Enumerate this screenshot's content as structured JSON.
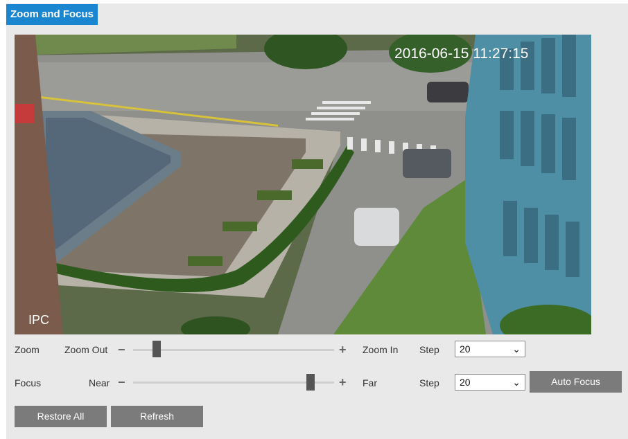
{
  "header": {
    "title": "Zoom and Focus"
  },
  "video": {
    "timestamp": "2016-06-15 11:27:15",
    "watermark": "IPC"
  },
  "zoom": {
    "label": "Zoom",
    "minus_label": "Zoom Out",
    "plus_label": "Zoom In",
    "position_fraction": 0.1,
    "step_label": "Step",
    "step_value": "20"
  },
  "focus": {
    "label": "Focus",
    "minus_label": "Near",
    "plus_label": "Far",
    "position_fraction": 0.9,
    "step_label": "Step",
    "step_value": "20",
    "auto_focus_label": "Auto Focus"
  },
  "actions": {
    "restore_all_label": "Restore All",
    "refresh_label": "Refresh"
  },
  "colors": {
    "accent": "#1a86cf",
    "button": "#7b7b7b",
    "panel": "#e9e9e9"
  },
  "icons": {
    "minus": "minus-icon",
    "plus": "plus-icon",
    "dropdown": "chevron-down-icon"
  }
}
